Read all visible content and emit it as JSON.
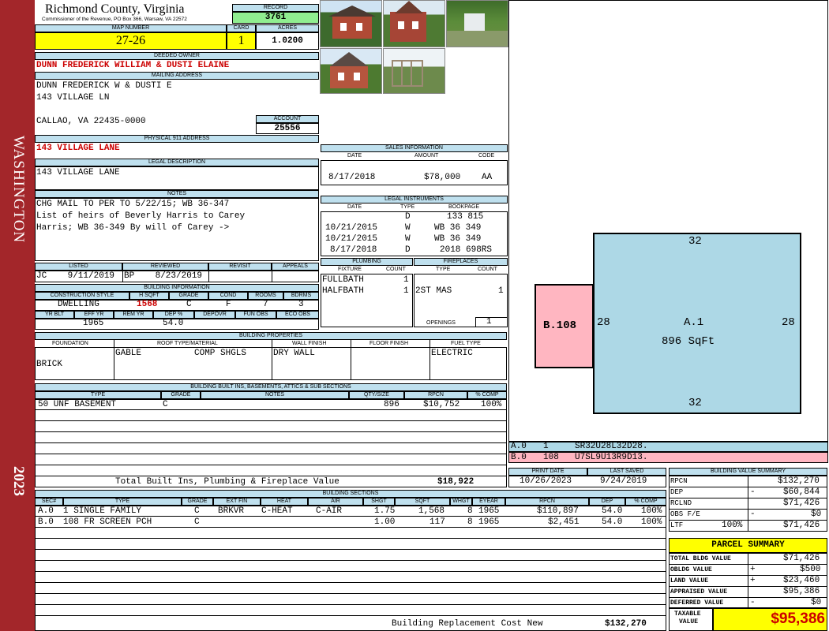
{
  "side": {
    "name": "WASHINGTON",
    "year": "2023"
  },
  "header": {
    "county": "Richmond County, Virginia",
    "commissioner": "Commissioner of the Revenue, PO Box 366, Warsaw, VA 22572",
    "record_label": "RECORD",
    "record": "3761",
    "map_label": "MAP NUMBER",
    "map": "27-26",
    "card_label": "CARD",
    "card": "1",
    "acres_label": "ACRES",
    "acres": "1.0200"
  },
  "owner": {
    "label": "DEEDED OWNER",
    "name": "DUNN FREDERICK WILLIAM & DUSTI ELAINE",
    "mail_label": "MAILING ADDRESS",
    "mail1": "DUNN FREDERICK W & DUSTI E",
    "mail2": "143 VILLAGE LN",
    "mail3": "CALLAO, VA 22435-0000",
    "account_label": "ACCOUNT",
    "account": "25556",
    "phys_label": "PHYSICAL 911 ADDRESS",
    "phys": "143 VILLAGE LANE",
    "legal_label": "LEGAL DESCRIPTION",
    "legal": "143 VILLAGE LANE",
    "notes_label": "NOTES",
    "notes1": "CHG MAIL TO PER TO 5/22/15; WB 36-347",
    "notes2": "List of heirs of Beverly Harris to Carey",
    "notes3": "Harris; WB 36-349 By will of Carey ->"
  },
  "sales": {
    "label": "SALES INFORMATION",
    "h_date": "DATE",
    "h_amount": "AMOUNT",
    "h_code": "CODE",
    "date": "8/17/2018",
    "amount": "$78,000",
    "code": "AA"
  },
  "legal_inst": {
    "label": "LEGAL INSTRUMENTS",
    "h_date": "DATE",
    "h_type": "TYPE",
    "h_book": "BOOKPAGE",
    "rows": [
      [
        "",
        "D",
        "133 815"
      ],
      [
        "10/21/2015",
        "W",
        "WB 36 349"
      ],
      [
        "10/21/2015",
        "W",
        "WB 36 349"
      ],
      [
        "8/17/2018",
        "D",
        "2018 698RS"
      ]
    ]
  },
  "plumbing": {
    "label": "PLUMBING",
    "h_fix": "FIXTURE",
    "h_count": "COUNT",
    "r1": "FULLBATH",
    "c1": "1",
    "r2": "HALFBATH",
    "c2": "1"
  },
  "fireplaces": {
    "label": "FIREPLACES",
    "h_type": "TYPE",
    "h_count": "COUNT",
    "r1": "2ST MAS",
    "c1": "1",
    "open_label": "OPENINGS",
    "open": "1"
  },
  "listed": {
    "h_listed": "LISTED",
    "h_reviewed": "REVIEWED",
    "h_revisit": "REVISIT",
    "h_appeals": "APPEALS",
    "listed": "JC    9/11/2019",
    "reviewed": "BP    8/23/2019"
  },
  "building": {
    "label": "BUILDING INFORMATION",
    "h_style": "CONSTRUCTION STYLE",
    "h_hsqft": "H SQFT",
    "h_grade": "GRADE",
    "h_cond": "COND",
    "h_rooms": "ROOMS",
    "h_bdrms": "BDRMS",
    "style": "DWELLING",
    "hsqft": "1568",
    "grade": "C",
    "cond": "F",
    "rooms": "7",
    "bdrms": "3",
    "h_yrblt": "YR BLT",
    "h_effyr": "EFF YR",
    "h_remyr": "REM YR",
    "h_dep": "DEP %",
    "h_depovr": "DEPOVR",
    "h_funobs": "FUN OBS",
    "h_ecoobs": "ECO OBS",
    "effyr": "1965",
    "dep": "54.0"
  },
  "props": {
    "label": "BUILDING PROPERTIES",
    "h_found": "FOUNDATION",
    "h_roof": "ROOF TYPE/MATERIAL",
    "h_wall": "WALL FINISH",
    "h_floor": "FLOOR FINISH",
    "h_fuel": "FUEL TYPE",
    "found": "BRICK",
    "roof1": "GABLE",
    "roof2": "COMP SHGLS",
    "wall": "DRY WALL",
    "fuel": "ELECTRIC"
  },
  "builtins": {
    "label": "BUILDING BUILT INS, BASEMENTS, ATTICS & SUB SECTIONS",
    "h_type": "TYPE",
    "h_grade": "GRADE",
    "h_notes": "NOTES",
    "h_qty": "QTY/SIZE",
    "h_rpcn": "RPCN",
    "h_comp": "% COMP",
    "type": "50 UNF BASEMENT",
    "grade": "C",
    "qty": "896",
    "rpcn": "$10,752",
    "comp": "100%",
    "total_label": "Total Built Ins, Plumbing & Fireplace Value",
    "total": "$18,922"
  },
  "sections": {
    "label": "BUILDING SECTIONS",
    "h_sec": "SEC#",
    "h_type": "TYPE",
    "h_grade": "GRADE",
    "h_ext": "EXT FIN",
    "h_heat": "HEAT",
    "h_air": "AIR",
    "h_shgt": "SHGT",
    "h_sqft": "SQFT",
    "h_whgt": "WHGT",
    "h_eyear": "EYEAR",
    "h_rpcn": "RPCN",
    "h_dep": "DEP",
    "h_comp": "% COMP",
    "rows": [
      [
        "A.0",
        "1 SINGLE FAMILY",
        "C",
        "BRKVR",
        "C-HEAT",
        "C-AIR",
        "1.75",
        "1,568",
        "8",
        "1965",
        "$110,897",
        "54.0",
        "100%"
      ],
      [
        "B.0",
        "108 FR SCREEN PCH",
        "C",
        "",
        "",
        "",
        "1.00",
        "117",
        "8",
        "1965",
        "$2,451",
        "54.0",
        "100%"
      ]
    ],
    "brcn_label": "Building Replacement Cost New",
    "brcn": "$132,270"
  },
  "sketch": {
    "top": "32",
    "bottom": "32",
    "left": "28",
    "right": "28",
    "a_label": "A.1",
    "a_area": "896 SqFt",
    "b_label": "B.108",
    "code_a1": "A.0",
    "code_a2": "1",
    "code_a3": "SR32U28L32D28.",
    "code_b1": "B.0",
    "code_b2": "108",
    "code_b3": "U7SL9U13R9D13."
  },
  "dates": {
    "h_print": "PRINT DATE",
    "h_saved": "LAST SAVED",
    "print": "10/26/2023",
    "saved": "9/24/2019"
  },
  "value_summary": {
    "label": "BUILDING VALUE SUMMARY",
    "rows": [
      [
        "RPCN",
        "",
        "$132,270"
      ],
      [
        "DEP",
        "-",
        "$60,844"
      ],
      [
        "RCLND",
        "",
        "$71,426"
      ],
      [
        "OBS F/E",
        "-",
        "$0"
      ],
      [
        "LTF",
        "100%",
        "$71,426"
      ]
    ]
  },
  "parcel": {
    "label": "PARCEL SUMMARY",
    "rows": [
      [
        "TOTAL BLDG VALUE",
        "",
        "$71,426"
      ],
      [
        "OBLDG VALUE",
        "+",
        "$500"
      ],
      [
        "LAND VALUE",
        "+",
        "$23,460"
      ],
      [
        "APPRAISED VALUE",
        "",
        "$95,386"
      ],
      [
        "DEFERRED VALUE",
        "-",
        "$0"
      ]
    ],
    "taxable_label1": "TAXABLE",
    "taxable_label2": "VALUE",
    "taxable": "$95,386"
  },
  "colors": {
    "side": "#a3262a",
    "header": "#bfe0ee",
    "yellow": "#ffff00",
    "green": "#90ee90",
    "sketch_main": "#add8e6",
    "sketch_porch": "#ffb6c1"
  }
}
